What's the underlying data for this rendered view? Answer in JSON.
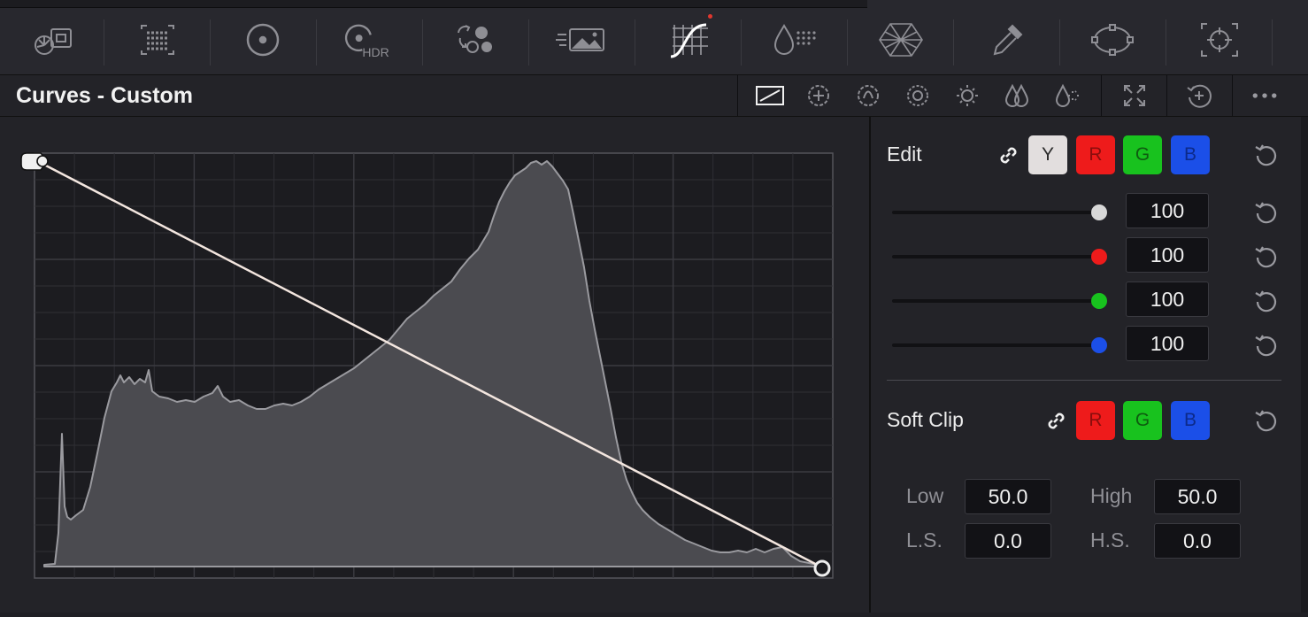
{
  "toolbar": {
    "items": [
      {
        "name": "camera-raw-icon"
      },
      {
        "name": "color-match-icon"
      },
      {
        "name": "color-wheels-icon"
      },
      {
        "name": "hdr-wheels-icon",
        "label": "HDR"
      },
      {
        "name": "rgb-mixer-icon"
      },
      {
        "name": "motion-effects-icon"
      },
      {
        "name": "curves-icon",
        "active": true
      },
      {
        "name": "color-warper-icon"
      },
      {
        "name": "qualifier-icon"
      },
      {
        "name": "window-icon"
      },
      {
        "name": "tracker-icon"
      }
    ]
  },
  "header": {
    "title": "Curves - Custom",
    "modes": [
      "custom-curve-icon",
      "hue-vs-hue-icon",
      "hue-vs-sat-icon",
      "hue-vs-lum-icon",
      "lum-vs-sat-icon",
      "sat-vs-sat-icon",
      "sat-vs-lum-icon"
    ],
    "actions": [
      "fullscreen-icon",
      "add-node-icon",
      "more-options-icon"
    ]
  },
  "edit": {
    "label": "Edit",
    "channels": {
      "y": "Y",
      "r": "R",
      "g": "G",
      "b": "B"
    },
    "sliders": [
      {
        "channel": "Y",
        "value": "100",
        "color": "#d8d8d8",
        "level": 1.0
      },
      {
        "channel": "R",
        "value": "100",
        "color": "#ee1b1b",
        "level": 1.0
      },
      {
        "channel": "G",
        "value": "100",
        "color": "#18c21e",
        "level": 1.0
      },
      {
        "channel": "B",
        "value": "100",
        "color": "#1b4fe8",
        "level": 1.0
      }
    ]
  },
  "soft_clip": {
    "label": "Soft Clip",
    "channels": {
      "r": "R",
      "g": "G",
      "b": "B"
    },
    "low_label": "Low",
    "low_value": "50.0",
    "high_label": "High",
    "high_value": "50.0",
    "ls_label": "L.S.",
    "ls_value": "0.0",
    "hs_label": "H.S.",
    "hs_value": "0.0"
  },
  "curve": {
    "start_point": [
      0,
      1
    ],
    "end_point": [
      1,
      0
    ]
  },
  "colors": {
    "accent_red": "#ee1b1b",
    "accent_green": "#18c21e",
    "accent_blue": "#1b4fe8",
    "curve_line": "#f3e6df"
  }
}
